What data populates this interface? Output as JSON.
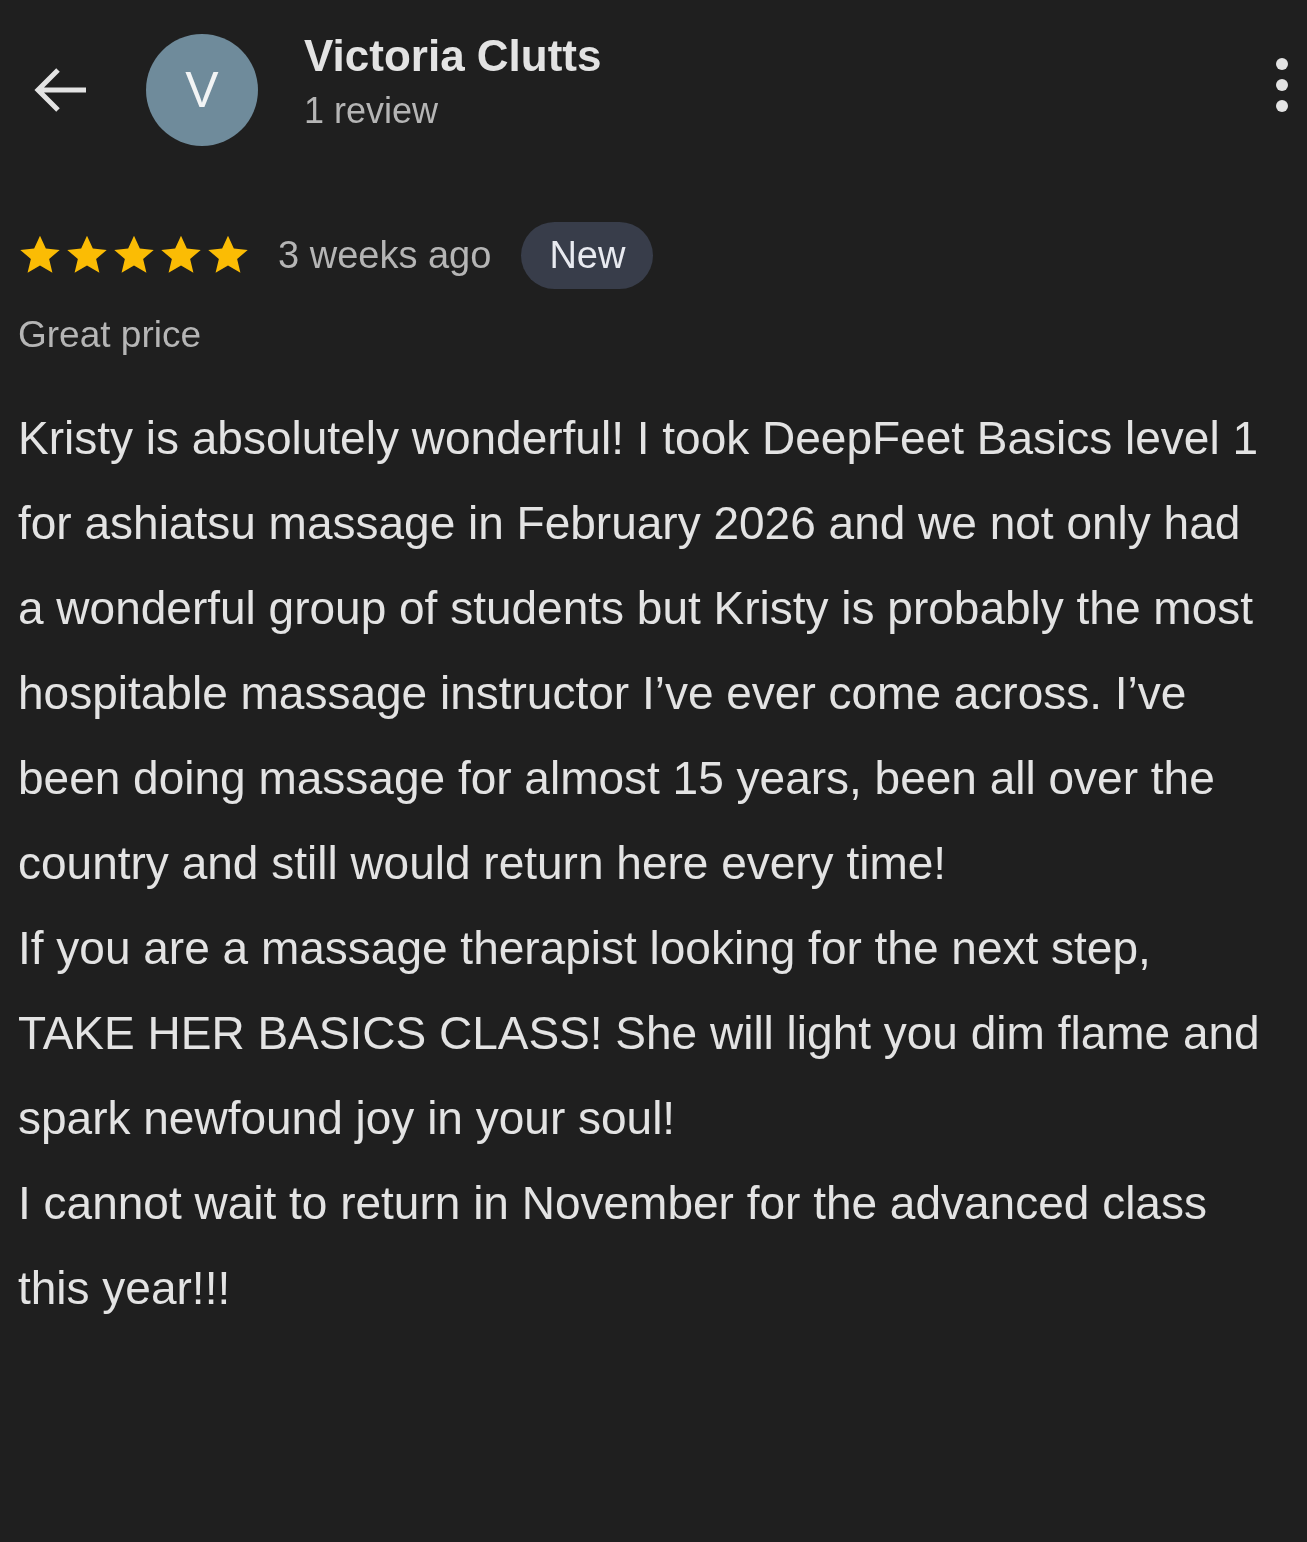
{
  "reviewer": {
    "initial": "V",
    "name": "Victoria Clutts",
    "review_count": "1 review"
  },
  "review": {
    "stars": 5,
    "time": "3 weeks ago",
    "badge": "New",
    "highlight": "Great price",
    "paragraphs": [
      "Kristy is absolutely wonderful! I took DeepFeet Basics level 1 for ashiatsu massage in February 2026 and we not only had a wonderful group of students but Kristy is probably the most hospitable massage instructor I’ve ever come across. I’ve been doing massage for almost 15 years, been all over the country and still would return here every time!",
      "If you are a massage therapist looking for the next step, TAKE HER BASICS CLASS! She will light you dim flame and spark newfound joy in your soul!",
      "I cannot wait to return in November for the advanced class this year!!!"
    ]
  }
}
